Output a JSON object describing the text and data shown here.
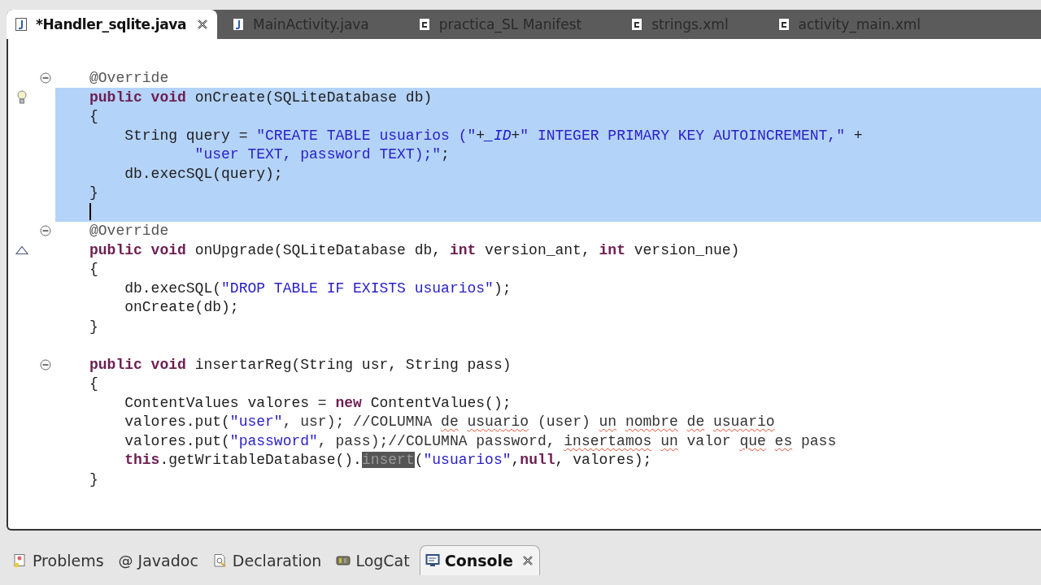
{
  "editor_tabs": [
    {
      "label": "*Handler_sqlite.java",
      "kind": "java",
      "selected": true,
      "closable": true
    },
    {
      "label": "MainActivity.java",
      "kind": "java",
      "selected": false,
      "closable": false
    },
    {
      "label": "practica_SL Manifest",
      "kind": "xml",
      "selected": false,
      "closable": false
    },
    {
      "label": "strings.xml",
      "kind": "xml",
      "selected": false,
      "closable": false
    },
    {
      "label": "activity_main.xml",
      "kind": "xml",
      "selected": false,
      "closable": false
    }
  ],
  "code_lines": [
    {
      "selected": false
    },
    {
      "fold_marker": true,
      "tokens": [
        {
          "t": "@Override",
          "kind": "annotation"
        }
      ],
      "selected": false
    },
    {
      "quick_fix": true,
      "tokens": [
        {
          "t": "public void",
          "kind": "keyword"
        },
        {
          "t": " onCreate(SQLiteDatabase db)",
          "kind": "plain"
        }
      ],
      "selected": true
    },
    {
      "tokens": [
        {
          "t": "{",
          "kind": "plain"
        }
      ],
      "selected": true
    },
    {
      "tokens": [
        {
          "t": "    String query = ",
          "kind": "plain"
        },
        {
          "t": "\"CREATE TABLE usuarios (\"",
          "kind": "string"
        },
        {
          "t": "+",
          "kind": "plain"
        },
        {
          "t": "_ID",
          "kind": "field"
        },
        {
          "t": "+",
          "kind": "plain"
        },
        {
          "t": "\" INTEGER PRIMARY KEY AUTOINCREMENT,\"",
          "kind": "string"
        },
        {
          "t": " +",
          "kind": "plain"
        }
      ],
      "selected": true
    },
    {
      "tokens": [
        {
          "t": "            \"user TEXT, password TEXT);\"",
          "kind": "string"
        },
        {
          "t": ";",
          "kind": "plain"
        }
      ],
      "selected": true
    },
    {
      "tokens": [
        {
          "t": "    db.execSQL(query);",
          "kind": "plain"
        }
      ],
      "selected": true
    },
    {
      "tokens": [
        {
          "t": "}",
          "kind": "plain"
        }
      ],
      "selected": true
    },
    {
      "caret": true,
      "selected": true
    },
    {
      "fold_marker": true,
      "tokens": [
        {
          "t": "@Override",
          "kind": "annotation"
        }
      ],
      "selected": false
    },
    {
      "override_marker": true,
      "tokens": [
        {
          "t": "public void",
          "kind": "keyword"
        },
        {
          "t": " onUpgrade(SQLiteDatabase db, ",
          "kind": "plain"
        },
        {
          "t": "int",
          "kind": "keyword"
        },
        {
          "t": " version_ant, ",
          "kind": "plain"
        },
        {
          "t": "int",
          "kind": "keyword"
        },
        {
          "t": " version_nue)",
          "kind": "plain"
        }
      ],
      "selected": false
    },
    {
      "tokens": [
        {
          "t": "{",
          "kind": "plain"
        }
      ],
      "selected": false
    },
    {
      "tokens": [
        {
          "t": "    db.execSQL(",
          "kind": "plain"
        },
        {
          "t": "\"DROP TABLE IF EXISTS usuarios\"",
          "kind": "string"
        },
        {
          "t": ");",
          "kind": "plain"
        }
      ],
      "selected": false
    },
    {
      "tokens": [
        {
          "t": "    onCreate(db);",
          "kind": "plain"
        }
      ],
      "selected": false
    },
    {
      "tokens": [
        {
          "t": "}",
          "kind": "plain"
        }
      ],
      "selected": false
    },
    {
      "selected": false
    },
    {
      "fold_marker": true,
      "tokens": [
        {
          "t": "public void",
          "kind": "keyword"
        },
        {
          "t": " insertarReg(String usr, String pass)",
          "kind": "plain"
        }
      ],
      "selected": false
    },
    {
      "tokens": [
        {
          "t": "{",
          "kind": "plain"
        }
      ],
      "selected": false
    },
    {
      "tokens": [
        {
          "t": "    ContentValues valores = ",
          "kind": "plain"
        },
        {
          "t": "new",
          "kind": "keyword"
        },
        {
          "t": " ContentValues();",
          "kind": "plain"
        }
      ],
      "selected": false
    },
    {
      "tokens": [
        {
          "t": "    valores.put(",
          "kind": "plain"
        },
        {
          "t": "\"user\"",
          "kind": "string"
        },
        {
          "t": ", usr); //COLUMNA ",
          "kind": "comment"
        },
        {
          "t": "de",
          "kind": "misspelled"
        },
        {
          "t": " usuario",
          "kind": "misspelled"
        },
        {
          "t": " (user) ",
          "kind": "comment"
        },
        {
          "t": "un",
          "kind": "misspelled"
        },
        {
          "t": " nombre",
          "kind": "misspelled"
        },
        {
          "t": " de",
          "kind": "misspelled"
        },
        {
          "t": " usuario",
          "kind": "misspelled"
        }
      ],
      "selected": false
    },
    {
      "tokens": [
        {
          "t": "    valores.put(",
          "kind": "plain"
        },
        {
          "t": "\"password\"",
          "kind": "string"
        },
        {
          "t": ", pass);//COLUMNA password, ",
          "kind": "comment"
        },
        {
          "t": "insertamos",
          "kind": "misspelled"
        },
        {
          "t": " un",
          "kind": "misspelled"
        },
        {
          "t": " valor ",
          "kind": "comment"
        },
        {
          "t": "que",
          "kind": "misspelled"
        },
        {
          "t": " es",
          "kind": "misspelled"
        },
        {
          "t": " pass",
          "kind": "comment"
        }
      ],
      "selected": false
    },
    {
      "tokens": [
        {
          "t": "    this",
          "kind": "keyword"
        },
        {
          "t": ".getWritableDatabase().",
          "kind": "plain"
        },
        {
          "t": "insert",
          "kind": "occurrence"
        },
        {
          "t": "(",
          "kind": "plain"
        },
        {
          "t": "\"usuarios\"",
          "kind": "string"
        },
        {
          "t": ",",
          "kind": "plain"
        },
        {
          "t": "null",
          "kind": "keyword"
        },
        {
          "t": ", valores);",
          "kind": "plain"
        }
      ],
      "selected": false
    },
    {
      "tokens": [
        {
          "t": "}",
          "kind": "plain"
        }
      ],
      "selected": false
    }
  ],
  "panel_tabs": [
    {
      "label": "Problems",
      "kind": "problems",
      "selected": false,
      "closable": false
    },
    {
      "label": "Javadoc",
      "kind": "javadoc",
      "glyph": "@",
      "selected": false,
      "closable": false
    },
    {
      "label": "Declaration",
      "kind": "declaration",
      "selected": false,
      "closable": false
    },
    {
      "label": "LogCat",
      "kind": "logcat",
      "selected": false,
      "closable": false
    },
    {
      "label": "Console",
      "kind": "console",
      "selected": true,
      "closable": true
    }
  ]
}
